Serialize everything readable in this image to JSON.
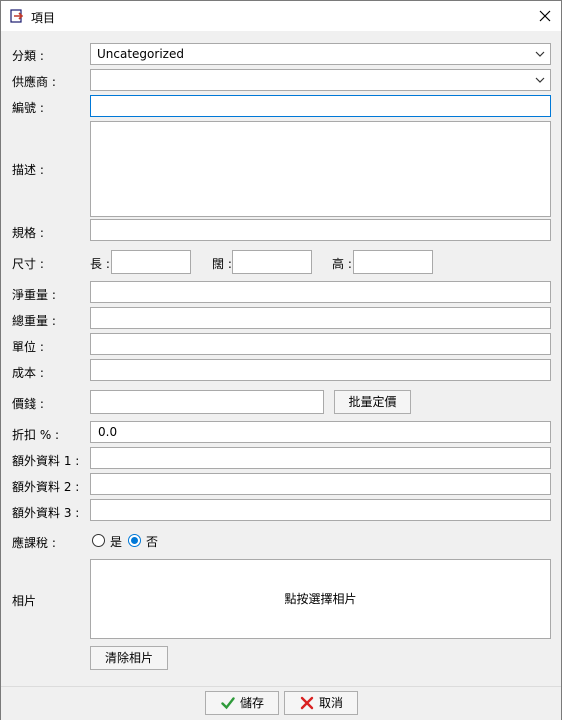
{
  "window": {
    "title": "項目"
  },
  "labels": {
    "category": "分類 :",
    "supplier": "供應商 :",
    "code": "編號 :",
    "description": "描述 :",
    "spec": "規格 :",
    "size": "尺寸 :",
    "length": "長 :",
    "width": "闊 :",
    "height": "高 :",
    "net_weight": "淨重量 :",
    "gross_weight": "總重量 :",
    "unit": "單位 :",
    "cost": "成本 :",
    "price": "價錢 :",
    "discount": "折扣 % :",
    "extra1": "額外資料 1 :",
    "extra2": "額外資料 2 :",
    "extra3": "額外資料 3 :",
    "taxable": "應課稅 :",
    "photo": "相片"
  },
  "fields": {
    "category_value": "Uncategorized",
    "supplier_value": "",
    "code_value": "",
    "spec_value": "",
    "length_value": "",
    "width_value": "",
    "height_value": "",
    "net_weight_value": "",
    "gross_weight_value": "",
    "unit_value": "",
    "cost_value": "",
    "price_value": "",
    "discount_value": "0.0",
    "extra1_value": "",
    "extra2_value": "",
    "extra3_value": ""
  },
  "taxable": {
    "yes_label": "是",
    "no_label": "否",
    "selected": "no"
  },
  "buttons": {
    "bulk_pricing": "批量定價",
    "photo_select": "點按選擇相片",
    "clear_photo": "清除相片",
    "save": "儲存",
    "cancel": "取消"
  },
  "colors": {
    "accent": "#0078d7",
    "save_icon": "#2e9a3a",
    "cancel_icon": "#d92121"
  }
}
